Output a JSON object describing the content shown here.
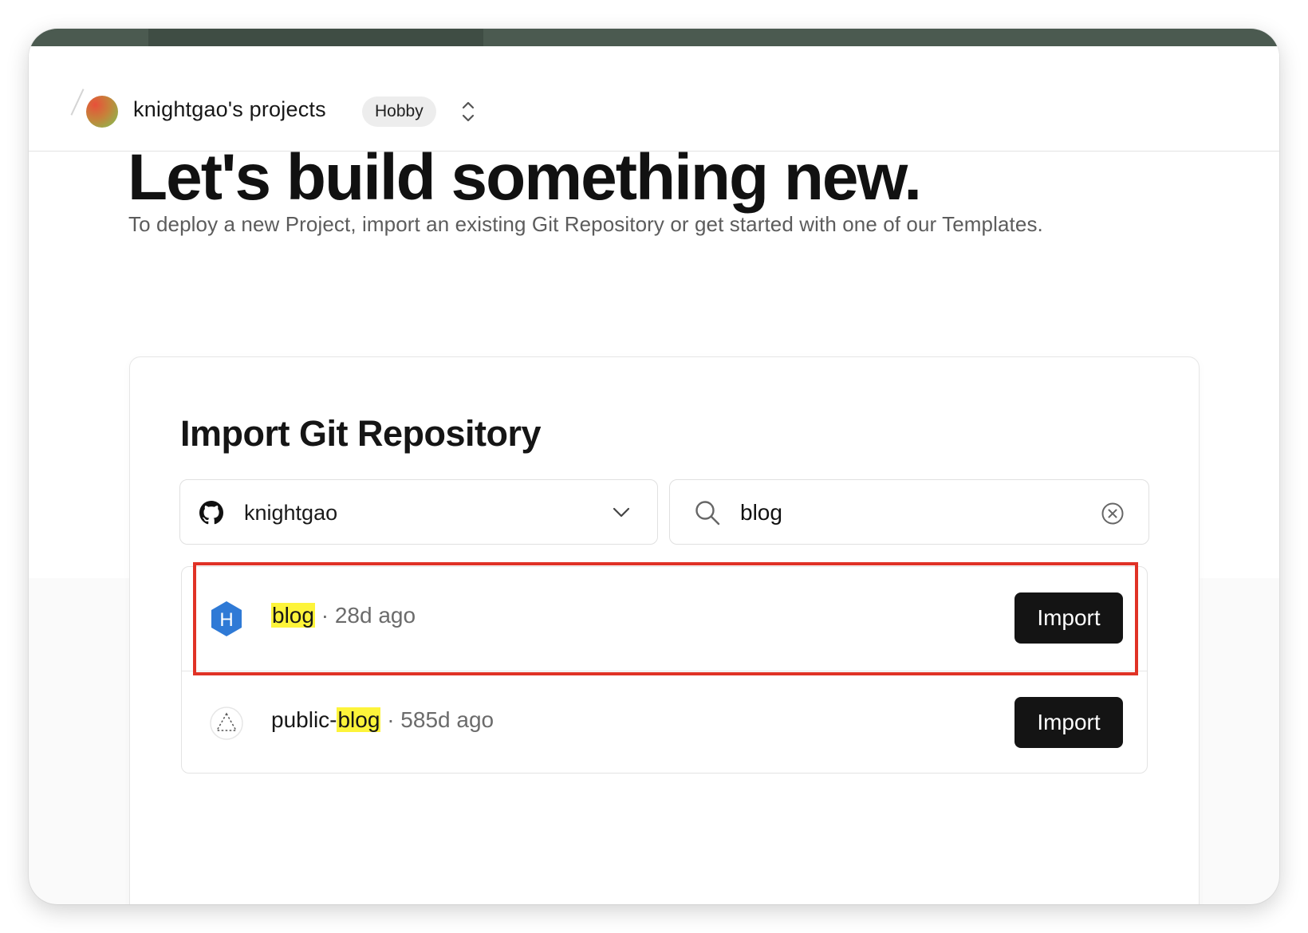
{
  "header": {
    "team_name": "knightgao's projects",
    "plan_badge": "Hobby"
  },
  "hero": {
    "title": "Let's build something new.",
    "subtitle": "To deploy a new Project, import an existing Git Repository or get started with one of our Templates."
  },
  "import_card": {
    "title": "Import Git Repository",
    "account_selector": {
      "value": "knightgao",
      "icon": "github-icon"
    },
    "search": {
      "value": "blog",
      "icon": "search-icon"
    },
    "repos": [
      {
        "name_prefix": "",
        "name_match": "blog",
        "meta": " · 28d ago",
        "icon": "hexo-icon",
        "action": "Import"
      },
      {
        "name_prefix": "public-",
        "name_match": "blog",
        "meta": " · 585d ago",
        "icon": "placeholder-triangle-icon",
        "action": "Import"
      }
    ]
  },
  "colors": {
    "highlight": "#fdf43a",
    "annotation_box": "#e03226",
    "button": "#141414",
    "hexo_blue": "#2f7ad6"
  }
}
